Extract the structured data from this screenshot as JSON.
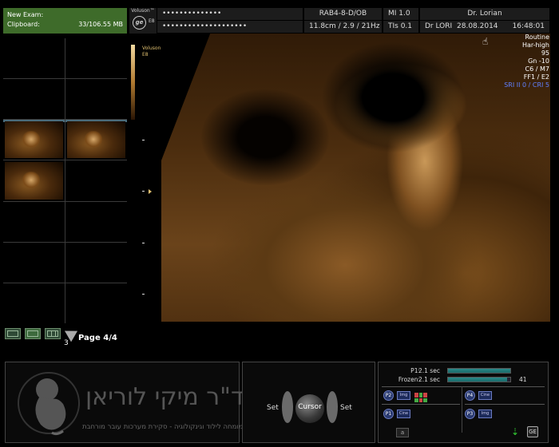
{
  "clipboard": {
    "title": "New Exam:",
    "label": "Clipboard:",
    "size": "33/106.55 MB",
    "page_count": "3",
    "page_label": "Page 4/4"
  },
  "header": {
    "logo": "Voluson™",
    "model": "E8",
    "patient_name_masked": "••••••••••••••",
    "patient_id_masked": "••••••••••••••••••••",
    "probe_app": "RAB4-8-D/OB",
    "mi": "MI  1.0",
    "physician": "Dr. Lorian",
    "depth_freq": "11.8cm / 2.9 / 21Hz",
    "tis": "TIs  0.1",
    "operator": "Dr LORI",
    "date": "28.08.2014",
    "time": "16:48:01"
  },
  "image_params": {
    "scale_logo": "Voluson",
    "scale_model": "E8",
    "lines": [
      "Routine",
      "Har-high",
      "95",
      "Gn -10",
      "C6 / M7",
      "FF1 / E2"
    ],
    "highlight": "SRI II 0 / CRI 5",
    "highlight_color": "#6080ff"
  },
  "branding": {
    "main": "ד\"ר מיקי לוריאן",
    "sub": "מומחה לילוד וגינקולוגיה - סקירת מערכות עובר מורחבת"
  },
  "cursor_panel": {
    "left_label": "Set",
    "center_label": "Cursor",
    "right_label": "Set"
  },
  "status_panel": {
    "p1_label": "P1:",
    "p1_time": "2.1 sec",
    "p1_fill": 1.0,
    "frozen_label": "Frozen:",
    "frozen_time": "2.1 sec",
    "frozen_fill": 0.95,
    "frozen_count": "41",
    "presets": [
      {
        "id": "P2",
        "type": "Img"
      },
      {
        "id": "P4",
        "type": "Cine"
      },
      {
        "id": "P1",
        "type": "Cine"
      },
      {
        "id": "P3",
        "type": "Img"
      }
    ],
    "a_key": "a",
    "ge_icon": "GE"
  }
}
